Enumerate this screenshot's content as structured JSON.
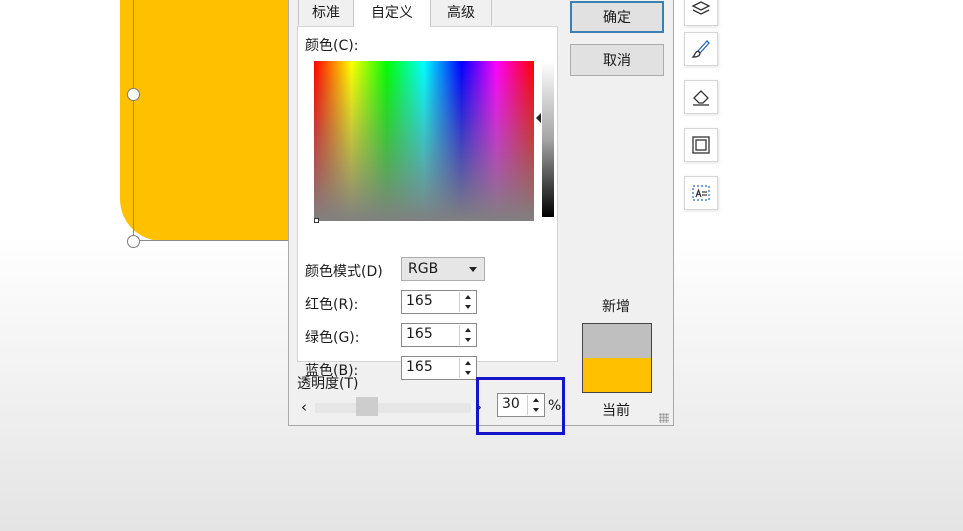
{
  "slide": {
    "shape_color": "#ffc000"
  },
  "dialog": {
    "tabs": [
      "标准",
      "自定义",
      "高级"
    ],
    "active_tab": "自定义",
    "colors_label": "颜色(C):",
    "color_mode_label": "颜色模式(D)",
    "color_mode_value": "RGB",
    "red_label": "红色(R):",
    "red_value": "165",
    "green_label": "绿色(G):",
    "green_value": "165",
    "blue_label": "蓝色(B):",
    "blue_value": "165",
    "transparency_label": "透明度(T)",
    "transparency_value": "30",
    "transparency_unit": "%",
    "ok_label": "确定",
    "cancel_label": "取消",
    "new_label": "新增",
    "current_label": "当前",
    "new_color": "#bfbfbf",
    "current_color": "#ffc000"
  },
  "toolbar": {
    "icons": [
      "layers-icon",
      "brush-icon",
      "eraser-icon",
      "frame-icon",
      "text-box-icon"
    ]
  },
  "annotation": {
    "highlight_color": "#1414c8"
  }
}
